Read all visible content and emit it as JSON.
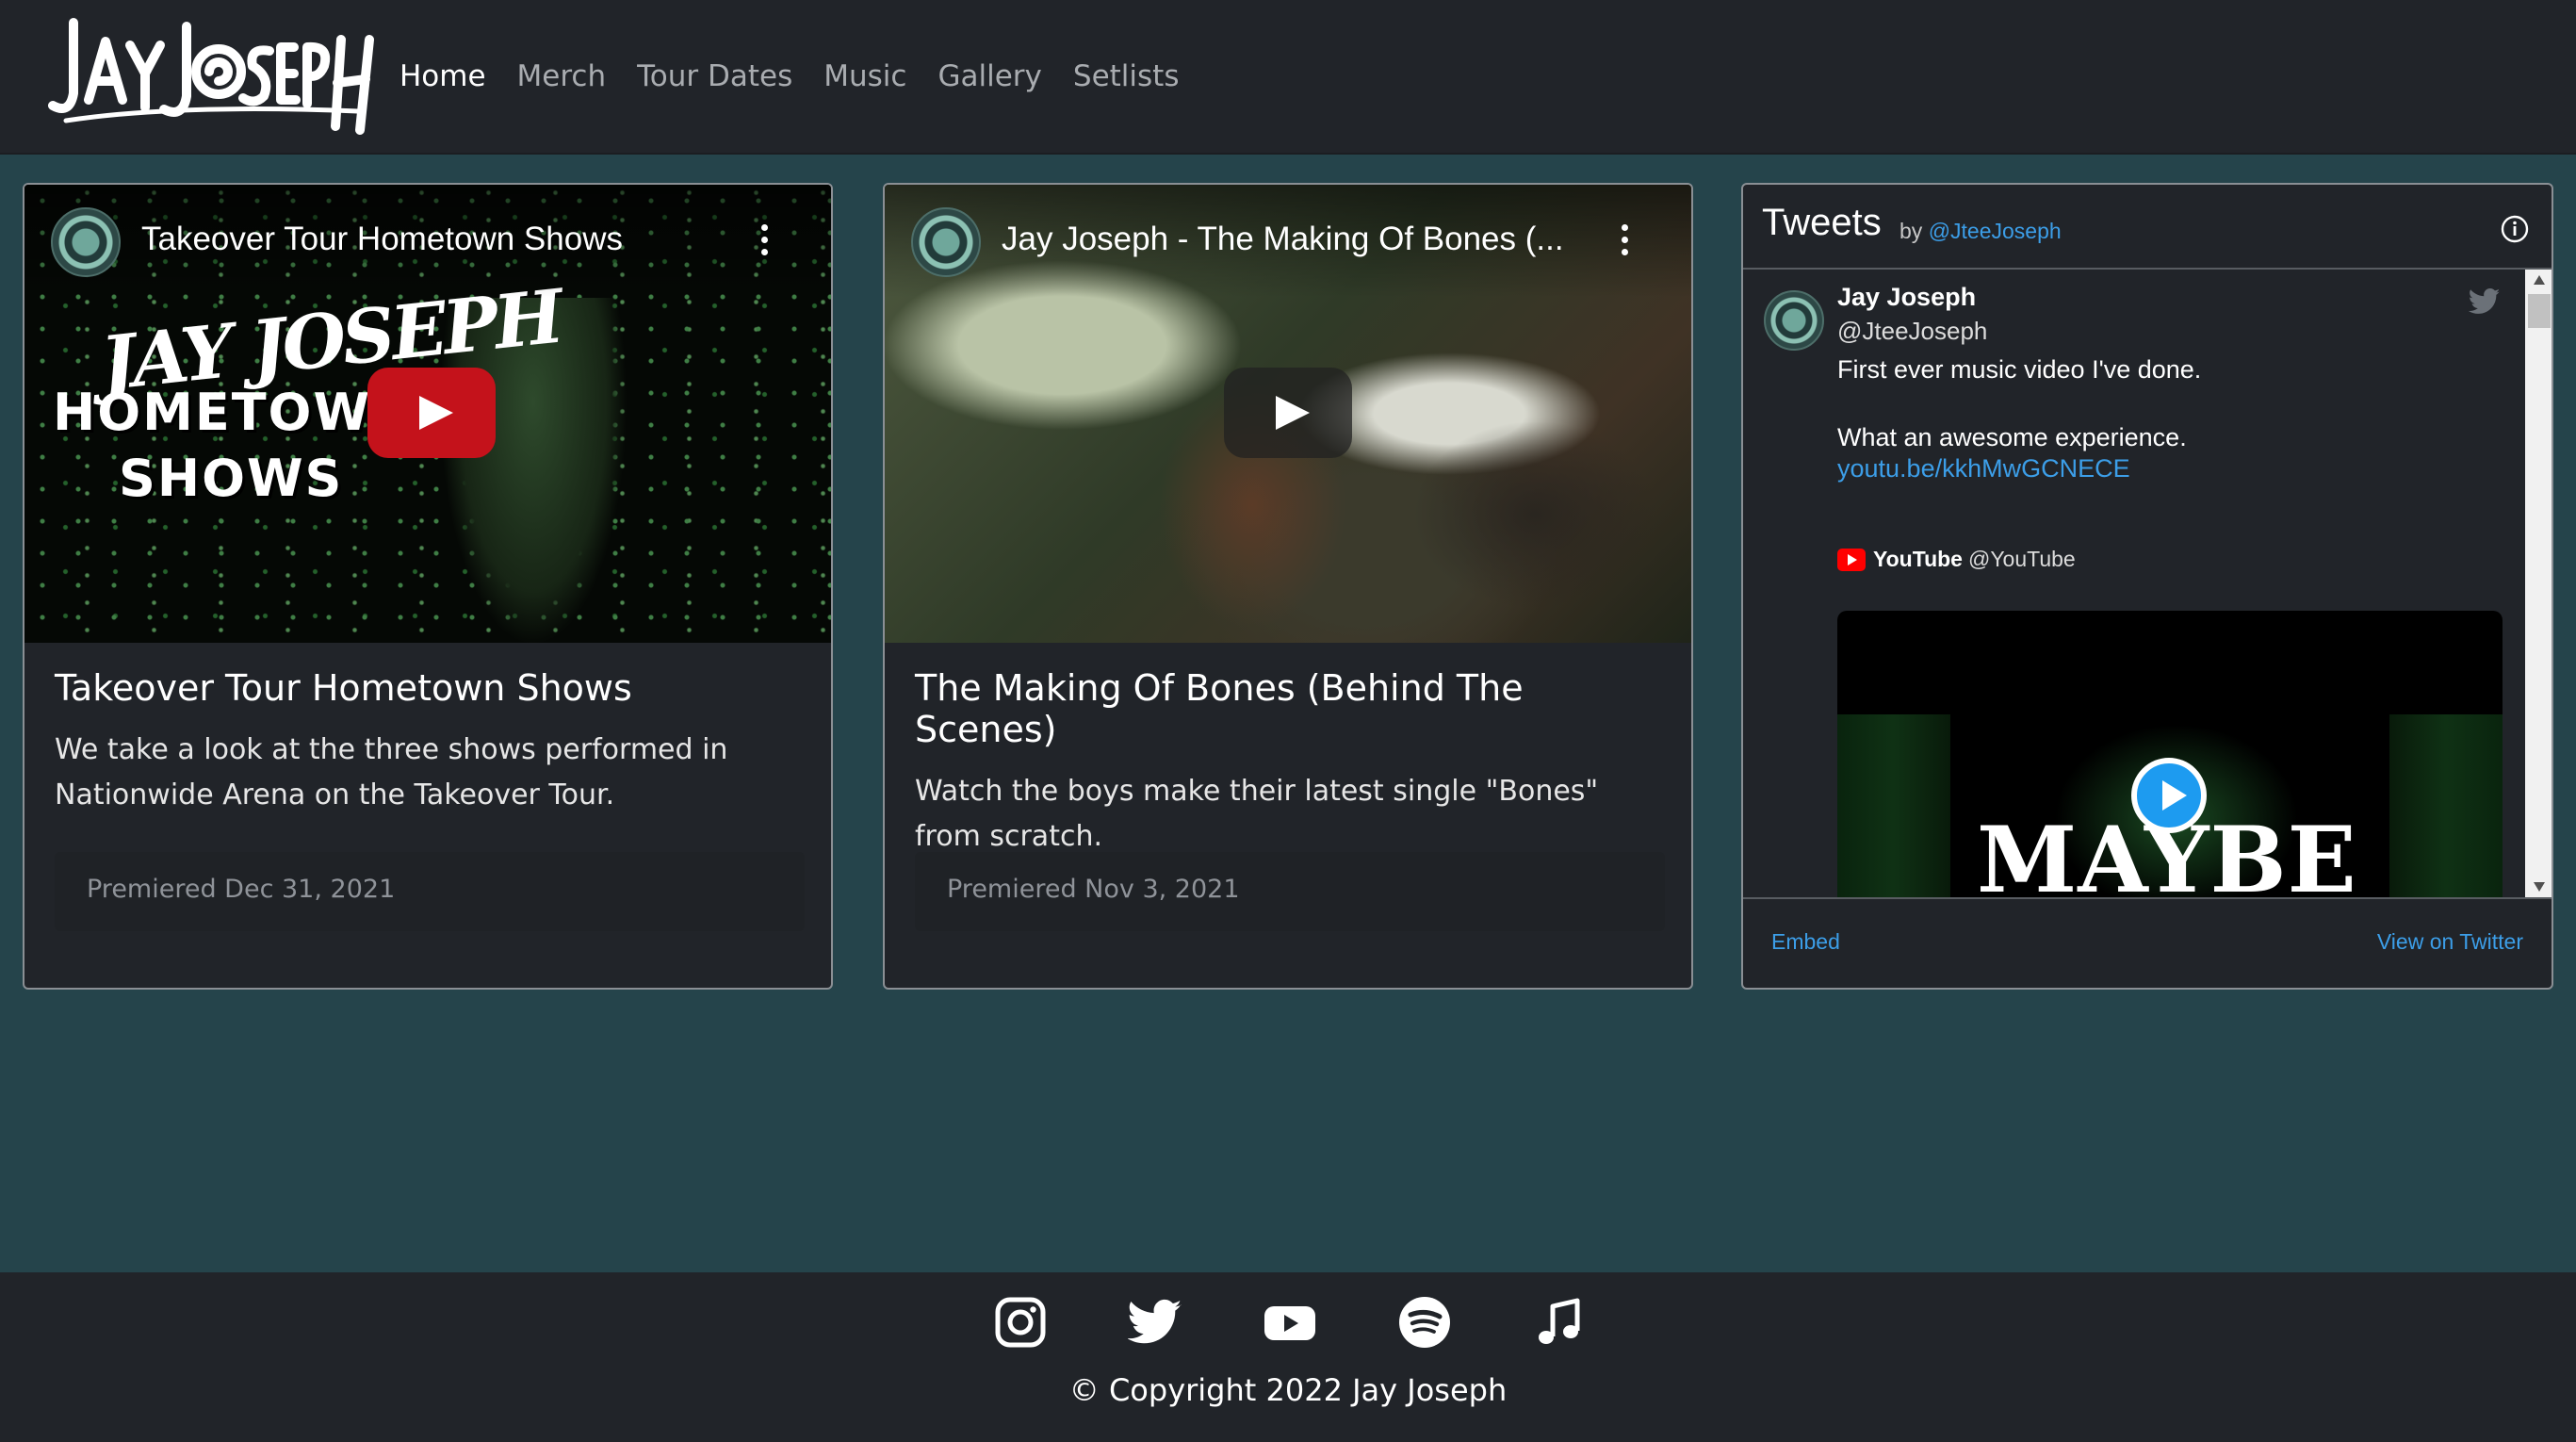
{
  "brand": {
    "logo_text": "JAY JOSEPH"
  },
  "nav": {
    "items": [
      {
        "label": "Home",
        "active": true
      },
      {
        "label": "Merch"
      },
      {
        "label": "Tour Dates"
      },
      {
        "label": "Music"
      },
      {
        "label": "Gallery"
      },
      {
        "label": "Setlists"
      }
    ]
  },
  "cards": [
    {
      "video_title": "Takeover Tour Hometown Shows",
      "poster": {
        "logo_text": "JAY JOSEPH",
        "line1": "HOMETOWN",
        "line2": "SHOWS"
      },
      "title": "Takeover Tour Hometown Shows",
      "text": "We take a look at the three shows performed in Nationwide Arena on the Takeover Tour.",
      "footer": "Premiered Dec 31, 2021"
    },
    {
      "video_title": "Jay Joseph - The Making Of Bones (...",
      "title": "The Making Of Bones (Behind The Scenes)",
      "text": "Watch the boys make their latest single \"Bones\" from scratch.",
      "footer": "Premiered Nov 3, 2021"
    }
  ],
  "tweets": {
    "title": "Tweets",
    "by": "by",
    "by_handle": "@JteeJoseph",
    "tweet": {
      "name": "Jay Joseph",
      "handle": "@JteeJoseph",
      "line1": "First ever music video I've done.",
      "line2": "What an awesome experience.",
      "link": "youtu.be/kkhMwGCNECE",
      "card_source_name": "YouTube",
      "card_source_handle": "@YouTube",
      "media_text": "MAYBE"
    },
    "embed_label": "Embed",
    "view_label": "View on Twitter"
  },
  "footer": {
    "social_icons": [
      "instagram-icon",
      "twitter-icon",
      "youtube-icon",
      "spotify-icon",
      "music-note-icon"
    ],
    "copyright": "© Copyright 2022 Jay Joseph"
  },
  "colors": {
    "page_bg": "#25444b",
    "panel_bg": "#212429",
    "link_blue": "#3c9ee8",
    "youtube_red": "#c4121b"
  }
}
